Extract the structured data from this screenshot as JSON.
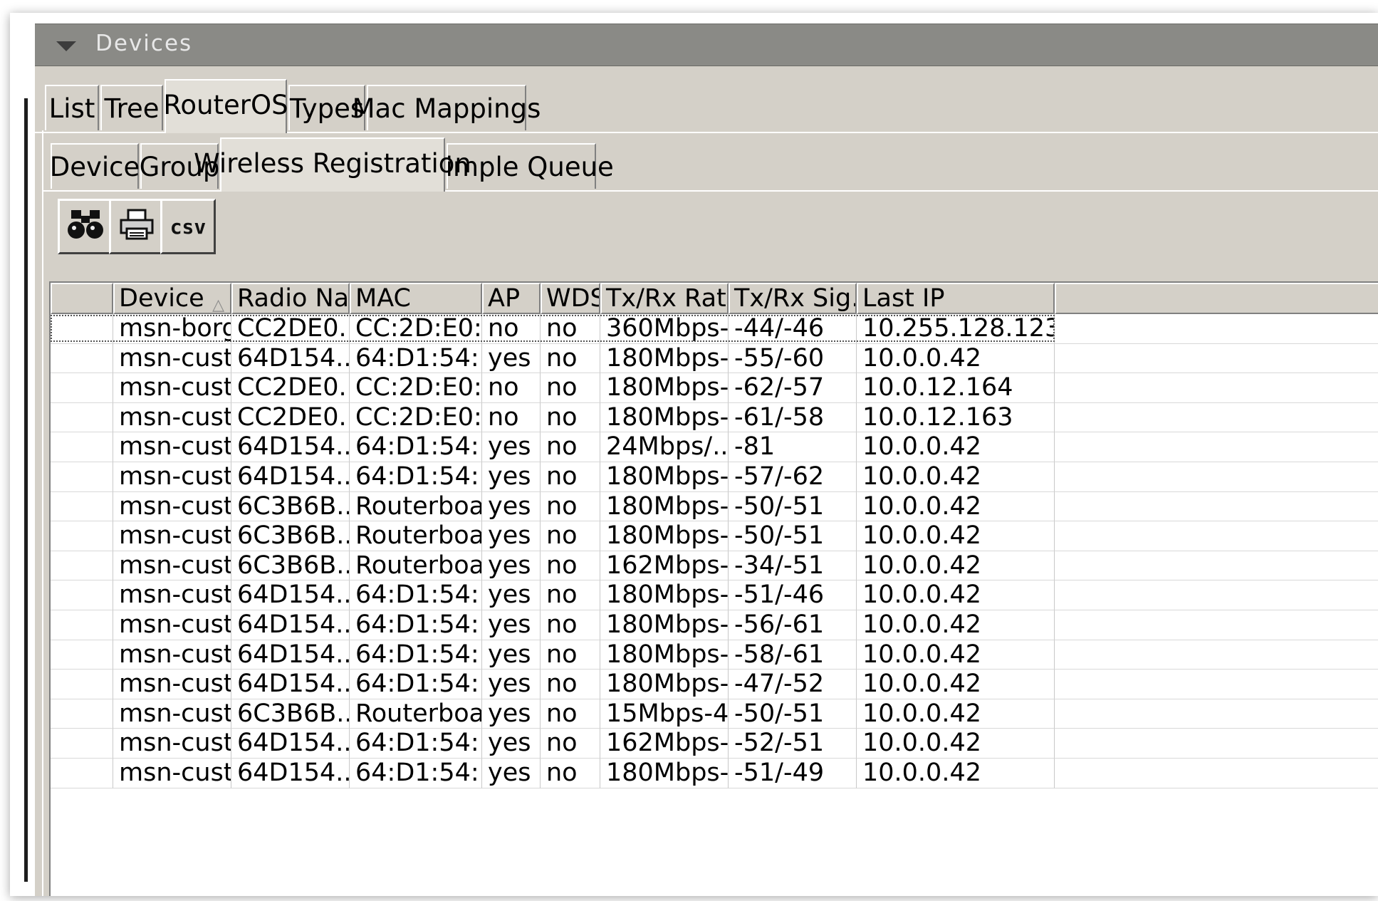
{
  "panel": {
    "title": "Devices",
    "collapse_icon": "triangle-down-icon"
  },
  "top_tabs": [
    {
      "label": "List",
      "active": false
    },
    {
      "label": "Tree",
      "active": false
    },
    {
      "label": "RouterOS",
      "active": true
    },
    {
      "label": "Types",
      "active": false
    },
    {
      "label": "Mac Mappings",
      "active": false
    }
  ],
  "sub_tabs": [
    {
      "label": "Device",
      "active": false
    },
    {
      "label": "Group",
      "active": false
    },
    {
      "label": "Wireless Registration",
      "active": true
    },
    {
      "label": "Simple Queue",
      "active": false
    }
  ],
  "toolbar": {
    "find_icon": "binoculars-icon",
    "print_icon": "printer-icon",
    "csv_label": "csv"
  },
  "table": {
    "columns": [
      "",
      "Device",
      "Radio Na...",
      "MAC",
      "AP",
      "WDS",
      "Tx/Rx Rate",
      "Tx/Rx Sig...",
      "Last IP",
      ""
    ],
    "sort_column": "Device",
    "sort_icon": "sort-ascending-icon",
    "rows": [
      [
        "",
        "msn-borg...",
        "CC2DE0...",
        "CC:2D:E0:...",
        "no",
        "no",
        "360Mbps-...",
        "-44/-46",
        "10.255.128.123",
        ""
      ],
      [
        "",
        "msn-cust...",
        "64D154...",
        "64:D1:54:...",
        "yes",
        "no",
        "180Mbps-...",
        "-55/-60",
        "10.0.0.42",
        ""
      ],
      [
        "",
        "msn-cust...",
        "CC2DE0...",
        "CC:2D:E0:...",
        "no",
        "no",
        "180Mbps-...",
        "-62/-57",
        "10.0.12.164",
        ""
      ],
      [
        "",
        "msn-cust...",
        "CC2DE0...",
        "CC:2D:E0:...",
        "no",
        "no",
        "180Mbps-...",
        "-61/-58",
        "10.0.12.163",
        ""
      ],
      [
        "",
        "msn-cust...",
        "64D154...",
        "64:D1:54:...",
        "yes",
        "no",
        "24Mbps/...",
        "-81",
        "10.0.0.42",
        ""
      ],
      [
        "",
        "msn-cust...",
        "64D154...",
        "64:D1:54:...",
        "yes",
        "no",
        "180Mbps-...",
        "-57/-62",
        "10.0.0.42",
        ""
      ],
      [
        "",
        "msn-cust...",
        "6C3B6B...",
        "Routerboa...",
        "yes",
        "no",
        "180Mbps-...",
        "-50/-51",
        "10.0.0.42",
        ""
      ],
      [
        "",
        "msn-cust...",
        "6C3B6B...",
        "Routerboa...",
        "yes",
        "no",
        "180Mbps-...",
        "-50/-51",
        "10.0.0.42",
        ""
      ],
      [
        "",
        "msn-cust...",
        "6C3B6B...",
        "Routerboa...",
        "yes",
        "no",
        "162Mbps-...",
        "-34/-51",
        "10.0.0.42",
        ""
      ],
      [
        "",
        "msn-cust...",
        "64D154...",
        "64:D1:54:...",
        "yes",
        "no",
        "180Mbps-...",
        "-51/-46",
        "10.0.0.42",
        ""
      ],
      [
        "",
        "msn-cust...",
        "64D154...",
        "64:D1:54:...",
        "yes",
        "no",
        "180Mbps-...",
        "-56/-61",
        "10.0.0.42",
        ""
      ],
      [
        "",
        "msn-cust...",
        "64D154...",
        "64:D1:54:...",
        "yes",
        "no",
        "180Mbps-...",
        "-58/-61",
        "10.0.0.42",
        ""
      ],
      [
        "",
        "msn-cust...",
        "64D154...",
        "64:D1:54:...",
        "yes",
        "no",
        "180Mbps-...",
        "-47/-52",
        "10.0.0.42",
        ""
      ],
      [
        "",
        "msn-cust...",
        "6C3B6B...",
        "Routerboa...",
        "yes",
        "no",
        "15Mbps-4...",
        "-50/-51",
        "10.0.0.42",
        ""
      ],
      [
        "",
        "msn-cust...",
        "64D154...",
        "64:D1:54:...",
        "yes",
        "no",
        "162Mbps-...",
        "-52/-51",
        "10.0.0.42",
        ""
      ],
      [
        "",
        "msn-cust...",
        "64D154...",
        "64:D1:54:...",
        "yes",
        "no",
        "180Mbps-...",
        "-51/-49",
        "10.0.0.42",
        ""
      ]
    ]
  }
}
